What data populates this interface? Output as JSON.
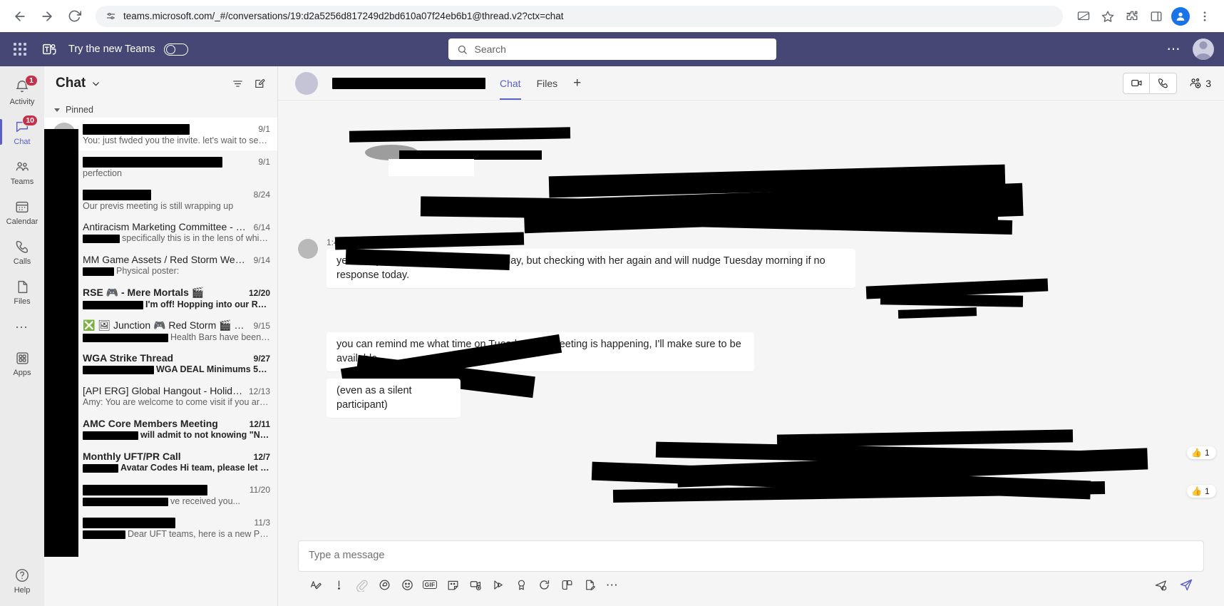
{
  "browser": {
    "back_icon": "arrow-left-icon",
    "forward_icon": "arrow-right-icon",
    "reload_icon": "reload-icon",
    "site_info_icon": "site-settings-icon",
    "url": "teams.microsoft.com/_#/conversations/19:d2a5256d817249d2bd610a07f24eb6b1@thread.v2?ctx=chat",
    "cast_icon": "cast-icon",
    "bookmark_icon": "star-icon",
    "extensions_icon": "extensions-icon",
    "sidepanel_icon": "side-panel-icon",
    "profile_icon": "profile-avatar-icon",
    "menu_icon": "three-dot-menu-icon"
  },
  "topbar": {
    "waffle_icon": "app-launcher-icon",
    "logo_icon": "teams-logo-icon",
    "try_new_teams_label": "Try the new Teams",
    "toggle_state": "off",
    "search_placeholder": "Search",
    "search_icon": "search-icon",
    "more_icon": "ellipsis-icon",
    "avatar_icon": "user-avatar"
  },
  "rail": {
    "items": [
      {
        "label": "Activity",
        "icon": "bell-icon",
        "badge": "1",
        "active": false
      },
      {
        "label": "Chat",
        "icon": "chat-icon",
        "badge": "10",
        "active": true
      },
      {
        "label": "Teams",
        "icon": "people-icon",
        "badge": "",
        "active": false
      },
      {
        "label": "Calendar",
        "icon": "calendar-icon",
        "badge": "",
        "active": false
      },
      {
        "label": "Calls",
        "icon": "phone-icon",
        "badge": "",
        "active": false
      },
      {
        "label": "Files",
        "icon": "file-icon",
        "badge": "",
        "active": false
      },
      {
        "label": "",
        "icon": "ellipsis-icon",
        "badge": "",
        "active": false
      },
      {
        "label": "Apps",
        "icon": "apps-grid-icon",
        "badge": "",
        "active": false
      }
    ],
    "help": {
      "label": "Help",
      "icon": "question-circle-icon"
    }
  },
  "chatlist": {
    "title": "Chat",
    "chevron_icon": "chevron-down-icon",
    "filter_icon": "filter-icon",
    "compose_icon": "compose-chat-icon",
    "section_label": "Pinned",
    "items": [
      {
        "name": "",
        "name_redacted": true,
        "date": "9/1",
        "preview": "You: just fwded you the invite. let's wait to see w...",
        "preview_redacted": false,
        "selected": true,
        "bold": false
      },
      {
        "name": "",
        "name_redacted": true,
        "date": "9/1",
        "preview": "perfection",
        "preview_redacted": false,
        "selected": false,
        "bold": false
      },
      {
        "name": "",
        "name_redacted": true,
        "date": "8/24",
        "preview": "Our previs meeting is still wrapping up",
        "preview_redacted": false,
        "selected": false,
        "bold": false
      },
      {
        "name": "Antiracism Marketing Committee - We...",
        "name_redacted": false,
        "date": "6/14",
        "preview": "specifically this is in the lens of white allys...",
        "preview_redacted": true,
        "selected": false,
        "bold": false
      },
      {
        "name": "MM Game Assets / Red Storm Weekly",
        "name_redacted": false,
        "date": "9/14",
        "preview": "Physical poster:",
        "preview_redacted": true,
        "selected": false,
        "bold": false
      },
      {
        "name": "RSE 🎮 - Mere Mortals 🎬",
        "name_redacted": false,
        "date": "12/20",
        "preview": "I'm off! Hopping into our RSE weekly, but f...",
        "preview_redacted": true,
        "selected": false,
        "bold": true
      },
      {
        "name": "❎ 🖼 Junction 🎮 Red Storm 🎬 Ubi-...",
        "name_redacted": false,
        "date": "9/15",
        "preview": "Health Bars have been added to t...",
        "preview_redacted": true,
        "selected": false,
        "bold": false
      },
      {
        "name": "WGA Strike Thread",
        "name_redacted": false,
        "date": "9/27",
        "preview": "WGA DEAL Minimums 5% increase Y...",
        "preview_redacted": true,
        "selected": false,
        "bold": true
      },
      {
        "name": "[API ERG] Global Hangout - Holiday E...",
        "name_redacted": false,
        "date": "12/13",
        "preview": "Amy: You are welcome to come visit if you are e...",
        "preview_redacted": false,
        "selected": false,
        "bold": false
      },
      {
        "name": "AMC Core Members Meeting",
        "name_redacted": false,
        "date": "12/11",
        "preview": "will admit to not knowing \"Nonsense\"",
        "preview_redacted": true,
        "selected": false,
        "bold": true
      },
      {
        "name": "Monthly UFT/PR Call",
        "name_redacted": false,
        "date": "12/7",
        "preview": "Avatar Codes Hi team, please let me kno...",
        "preview_redacted": true,
        "selected": false,
        "bold": true
      },
      {
        "name": "",
        "name_redacted": true,
        "date": "11/20",
        "preview": "ve received you...",
        "preview_redacted": true,
        "selected": false,
        "bold": false
      },
      {
        "name": "",
        "name_redacted": true,
        "date": "11/3",
        "preview": "Dear UFT teams, here is a new Parrot ...",
        "preview_redacted": true,
        "selected": false,
        "bold": false
      }
    ]
  },
  "conversation": {
    "title_redacted": true,
    "tabs": [
      {
        "label": "Chat",
        "active": true
      },
      {
        "label": "Files",
        "active": false
      }
    ],
    "add_tab_label": "+",
    "video_call_icon": "video-camera-icon",
    "audio_call_icon": "phone-icon",
    "people_icon": "people-add-icon",
    "people_count": "3",
    "messages": [
      {
        "id": "m1",
        "side": "left",
        "timestamp": "1:46 PM",
        "text": "yesterday assuming MB went on holiday, but checking with her again and will nudge Tuesday morning if no response today.",
        "partially_redacted": true
      },
      {
        "id": "m2",
        "side": "left",
        "timestamp": "",
        "text": "you can remind me what time on Tuesday that meeting is happening, I'll make sure to be available",
        "partially_redacted": true
      },
      {
        "id": "m3",
        "side": "left",
        "timestamp": "",
        "text": "(even as a silent participant)",
        "partially_redacted": false
      }
    ],
    "reactions": [
      {
        "emoji": "👍",
        "count": "1"
      },
      {
        "emoji": "👍",
        "count": "1"
      }
    ],
    "seen_icon": "seen-check-icon"
  },
  "composer": {
    "placeholder": "Type a message",
    "tools": [
      {
        "name": "format-icon",
        "glyph": "A"
      },
      {
        "name": "important-icon",
        "glyph": "!"
      },
      {
        "name": "attach-icon",
        "glyph": "paperclip"
      },
      {
        "name": "loop-icon",
        "glyph": "loop"
      },
      {
        "name": "emoji-icon",
        "glyph": "smiley"
      },
      {
        "name": "gif-icon",
        "glyph": "GIF"
      },
      {
        "name": "sticker-icon",
        "glyph": "sticker"
      },
      {
        "name": "meet-now-icon",
        "glyph": "meet"
      },
      {
        "name": "stream-icon",
        "glyph": "stream"
      },
      {
        "name": "praise-icon",
        "glyph": "praise"
      },
      {
        "name": "approvals-icon",
        "glyph": "approvals"
      },
      {
        "name": "apps-icon",
        "glyph": "apps"
      },
      {
        "name": "forms-icon",
        "glyph": "forms"
      },
      {
        "name": "more-options-icon",
        "glyph": "..."
      }
    ],
    "schedule_icon": "schedule-send-icon",
    "send_icon": "send-icon"
  }
}
